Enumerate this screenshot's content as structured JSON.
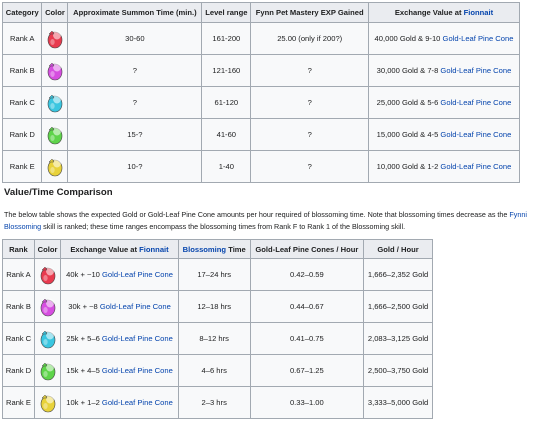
{
  "table1": {
    "headers": {
      "category": "Category",
      "color": "Color",
      "summon_time": "Approximate Summon Time (min.)",
      "level_range": "Level range",
      "mastery_exp": "Fynn Pet Mastery EXP Gained",
      "exchange_prefix": "Exchange Value at ",
      "exchange_link": "Fionnait"
    },
    "rows": [
      {
        "rank": "Rank A",
        "icon": "red-pet-egg-icon",
        "summon": "30-60",
        "level": "161-200",
        "exp": "25.00 (only if 200?)",
        "exchange": "40,000 Gold & 9-10 ",
        "cone": "Gold-Leaf Pine Cone"
      },
      {
        "rank": "Rank B",
        "icon": "magenta-pet-egg-icon",
        "summon": "?",
        "level": "121-160",
        "exp": "?",
        "exchange": "30,000 Gold & 7-8 ",
        "cone": "Gold-Leaf Pine Cone"
      },
      {
        "rank": "Rank C",
        "icon": "cyan-pet-egg-icon",
        "summon": "?",
        "level": "61-120",
        "exp": "?",
        "exchange": "25,000 Gold & 5-6 ",
        "cone": "Gold-Leaf Pine Cone"
      },
      {
        "rank": "Rank D",
        "icon": "green-pet-egg-icon",
        "summon": "15-?",
        "level": "41-60",
        "exp": "?",
        "exchange": "15,000 Gold & 4-5 ",
        "cone": "Gold-Leaf Pine Cone"
      },
      {
        "rank": "Rank E",
        "icon": "yellow-pet-egg-icon",
        "summon": "10-?",
        "level": "1-40",
        "exp": "?",
        "exchange": "10,000 Gold & 1-2 ",
        "cone": "Gold-Leaf Pine Cone"
      }
    ]
  },
  "section": {
    "heading": "Value/Time Comparison",
    "desc_part1": "The below table shows the expected Gold or Gold-Leaf Pine Cone amounts per hour required of blossoming time. Note that blossoming times decrease as the ",
    "desc_link": "Fynni Blossoming",
    "desc_part2": " skill is ranked; these time ranges encompass the blossoming times from Rank F to Rank 1 of the Blossoming skill."
  },
  "table2": {
    "headers": {
      "rank": "Rank",
      "color": "Color",
      "exchange_prefix": "Exchange Value at ",
      "exchange_link": "Fionnait",
      "blossoming_link": "Blossoming",
      "blossoming_suffix": " Time",
      "cones_hour": "Gold-Leaf Pine Cones / Hour",
      "gold_hour": "Gold / Hour"
    },
    "rows": [
      {
        "rank": "Rank A",
        "icon": "red-pet-egg-icon",
        "exchange": "40k + ~10 ",
        "cone": "Gold-Leaf Pine Cone",
        "time": "17–24 hrs",
        "cones": "0.42–0.59",
        "gold": "1,666–2,352 Gold"
      },
      {
        "rank": "Rank B",
        "icon": "magenta-pet-egg-icon",
        "exchange": "30k + ~8 ",
        "cone": "Gold-Leaf Pine Cone",
        "time": "12–18 hrs",
        "cones": "0.44–0.67",
        "gold": "1,666–2,500 Gold"
      },
      {
        "rank": "Rank C",
        "icon": "cyan-pet-egg-icon",
        "exchange": "25k + 5–6 ",
        "cone": "Gold-Leaf Pine Cone",
        "time": "8–12 hrs",
        "cones": "0.41–0.75",
        "gold": "2,083–3,125 Gold"
      },
      {
        "rank": "Rank D",
        "icon": "green-pet-egg-icon",
        "exchange": "15k + 4–5 ",
        "cone": "Gold-Leaf Pine Cone",
        "time": "4–6 hrs",
        "cones": "0.67–1.25",
        "gold": "2,500–3,750 Gold"
      },
      {
        "rank": "Rank E",
        "icon": "yellow-pet-egg-icon",
        "exchange": "10k + 1–2 ",
        "cone": "Gold-Leaf Pine Cone",
        "time": "2–3 hrs",
        "cones": "0.33–1.00",
        "gold": "3,333–5,000 Gold"
      }
    ]
  },
  "colors": {
    "link": "#0645ad",
    "header_bg": "#eaecf0",
    "cell_bg": "#f8f9fa",
    "border": "#a2a9b1",
    "icon_red": "#e83a4e",
    "icon_magenta": "#d64ee0",
    "icon_cyan": "#3ac6e0",
    "icon_green": "#5ed44a",
    "icon_yellow": "#e8d23a"
  }
}
